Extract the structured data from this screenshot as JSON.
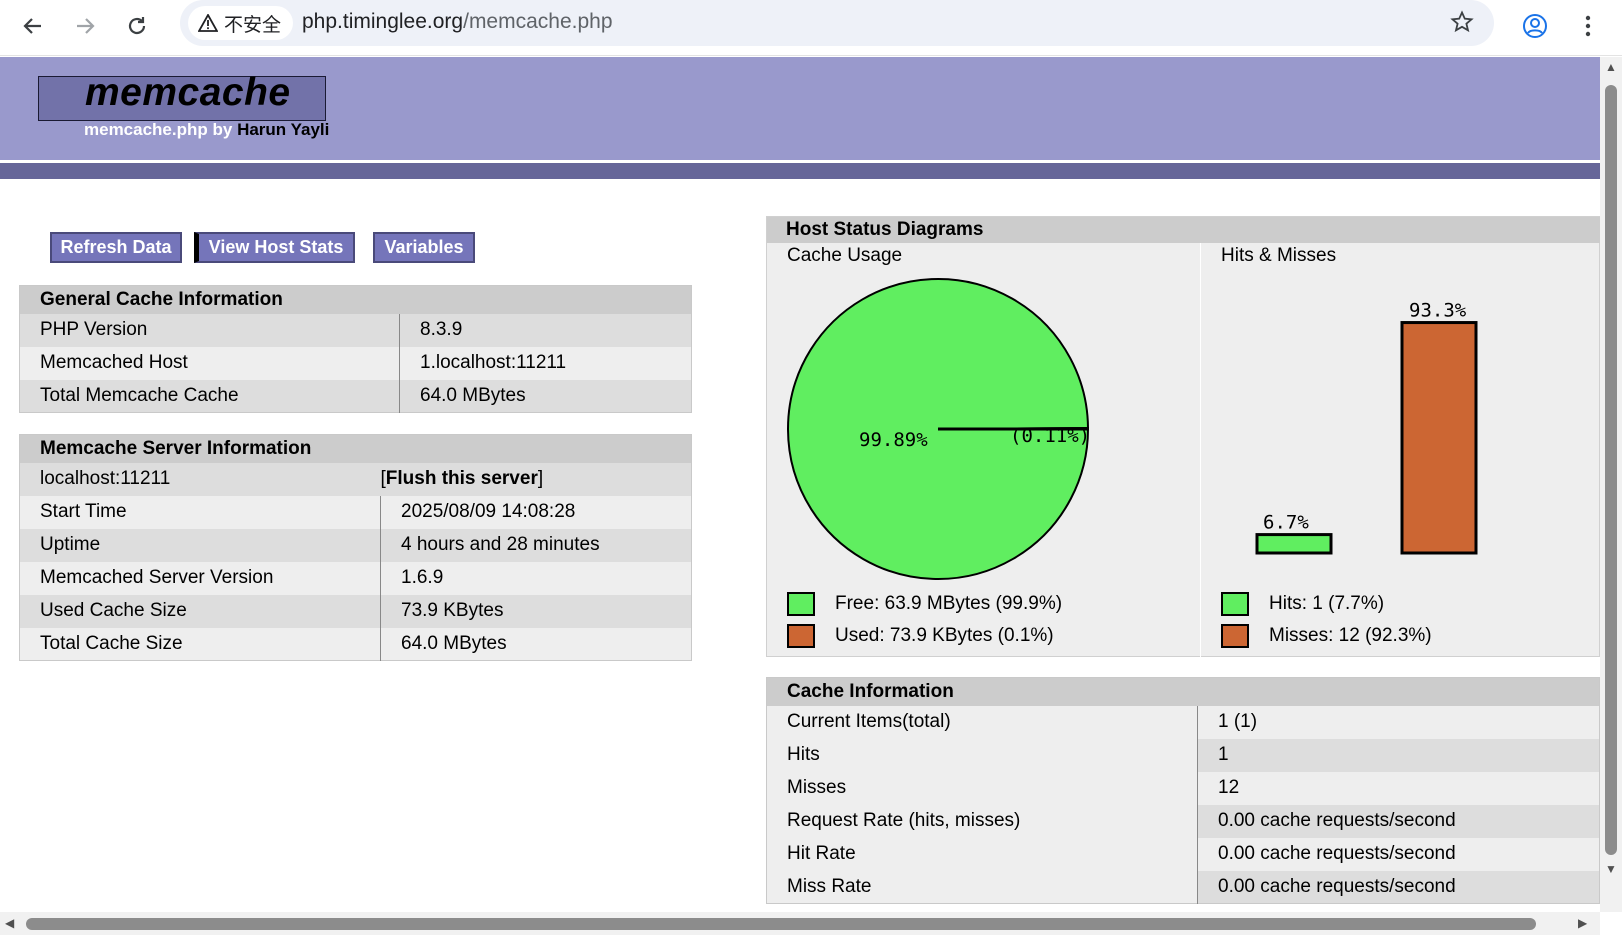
{
  "browser": {
    "security_label": "不安全",
    "url_host": "php.timinglee.org",
    "url_path": "/memcache.php"
  },
  "header": {
    "logo": "memcache",
    "byline": "memcache.php by",
    "author": "Harun Yayli"
  },
  "buttons": {
    "refresh": "Refresh Data",
    "host_stats": "View Host Stats",
    "variables": "Variables"
  },
  "general": {
    "title": "General Cache Information",
    "rows": [
      {
        "k": "PHP Version",
        "v": "8.3.9"
      },
      {
        "k": "Memcached Host",
        "v": "1.localhost:11211"
      },
      {
        "k": "Total Memcache Cache",
        "v": "64.0 MBytes"
      }
    ]
  },
  "server": {
    "title": "Memcache Server Information",
    "host": "localhost:11211",
    "flush_link": "Flush this server",
    "rows": [
      {
        "k": "Start Time",
        "v": "2025/08/09 14:08:28"
      },
      {
        "k": "Uptime",
        "v": "4 hours and 28 minutes"
      },
      {
        "k": "Memcached Server Version",
        "v": "1.6.9"
      },
      {
        "k": "Used Cache Size",
        "v": "73.9 KBytes"
      },
      {
        "k": "Total Cache Size",
        "v": "64.0 MBytes"
      }
    ]
  },
  "diagrams": {
    "title": "Host Status Diagrams",
    "cache_usage": {
      "subtitle": "Cache Usage",
      "free_pct": 99.89,
      "used_pct": 0.11,
      "free_label": "99.89%",
      "used_label": "(0.11%)",
      "legend_free": "Free: 63.9 MBytes (99.9%)",
      "legend_used": "Used: 73.9 KBytes (0.1%)"
    },
    "hits_misses": {
      "subtitle": "Hits & Misses",
      "hits_pct": 6.7,
      "misses_pct": 93.3,
      "hits_label": "6.7%",
      "misses_label": "93.3%",
      "legend_hits": "Hits: 1 (7.7%)",
      "legend_misses": "Misses: 12 (92.3%)"
    },
    "colors": {
      "free": "#60ee60",
      "used": "#cc6633"
    }
  },
  "cache_info": {
    "title": "Cache Information",
    "rows": [
      {
        "k": "Current Items(total)",
        "v": "1 (1)"
      },
      {
        "k": "Hits",
        "v": "1"
      },
      {
        "k": "Misses",
        "v": "12"
      },
      {
        "k": "Request Rate (hits, misses)",
        "v": "0.00 cache requests/second"
      },
      {
        "k": "Hit Rate",
        "v": "0.00 cache requests/second"
      },
      {
        "k": "Miss Rate",
        "v": "0.00 cache requests/second"
      }
    ]
  }
}
